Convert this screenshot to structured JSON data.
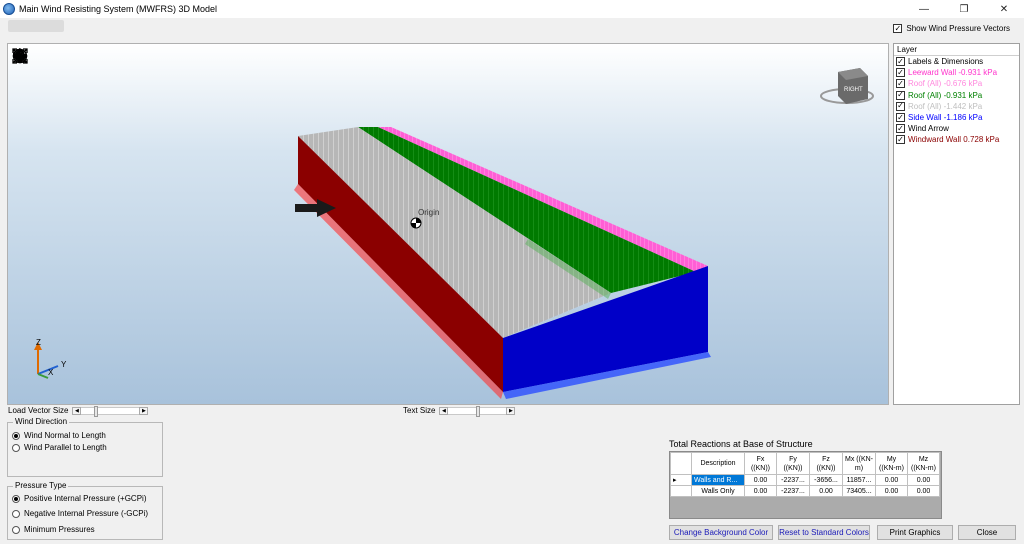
{
  "window": {
    "title": "Main Wind Resisting System (MWFRS) 3D Model",
    "minimize": "—",
    "restore": "❐",
    "close": "✕"
  },
  "options": {
    "show_wind_pressure_vectors": "Show Wind Pressure Vectors",
    "show_wind_pressure_vectors_checked": true
  },
  "viewport": {
    "origin_label": "Origin",
    "cube_label": "RIGHT",
    "axis_z": "Z",
    "axis_y": "Y",
    "axis_x": "X",
    "tools": [
      "home-icon",
      "orbit-icon",
      "zoom-window-icon",
      "zoom-icon",
      "pan-icon",
      "rotate-icon",
      "fit-extents-icon"
    ],
    "colors": {
      "windward_wall": "#8b0000",
      "side_wall": "#0000cc",
      "leeward_wall": "#ff33cc",
      "roof_green": "#008000",
      "roof_gray": "#b5b5b5"
    }
  },
  "layers": {
    "header": "Layer",
    "items": [
      {
        "label": "Labels & Dimensions",
        "color": "#000000",
        "checked": true
      },
      {
        "label": "Leeward Wall -0.931 kPa",
        "color": "#ff33cc",
        "checked": true
      },
      {
        "label": "Roof (All) -0.676 kPa",
        "color": "#ff88dd",
        "checked": true
      },
      {
        "label": "Roof (All) -0.931 kPa",
        "color": "#008000",
        "checked": true
      },
      {
        "label": "Roof (All) -1.442 kPa",
        "color": "#bfbfbf",
        "checked": true
      },
      {
        "label": "Side Wall -1.186 kPa",
        "color": "#0000ff",
        "checked": true
      },
      {
        "label": "Wind Arrow",
        "color": "#000000",
        "checked": true
      },
      {
        "label": "Windward Wall 0.728 kPa",
        "color": "#8b0000",
        "checked": true
      }
    ]
  },
  "controls": {
    "load_vector_size": "Load Vector Size",
    "load_vector_value": 0.2,
    "text_size": "Text Size",
    "text_size_value": 0.5
  },
  "wind_direction": {
    "title": "Wind Direction",
    "options": [
      {
        "label": "Wind Normal to Length",
        "selected": true
      },
      {
        "label": "Wind Parallel to Length",
        "selected": false
      }
    ]
  },
  "pressure_type": {
    "title": "Pressure Type",
    "options": [
      {
        "label": "Positive Internal Pressure (+GCPi)",
        "selected": true
      },
      {
        "label": "Negative Internal Pressure (-GCPi)",
        "selected": false
      },
      {
        "label": "Minimum Pressures",
        "selected": false
      }
    ]
  },
  "reactions": {
    "title": "Total Reactions at Base of Structure",
    "columns": [
      "Description",
      "Fx ((KN))",
      "Fy ((KN))",
      "Fz ((KN))",
      "Mx ((KN-m)",
      "My ((KN-m)",
      "Mz ((KN-m)"
    ],
    "rows": [
      {
        "marker": "▸",
        "cells": [
          "Walls and R...",
          "0.00",
          "-2237...",
          "-3656...",
          "11857...",
          "0.00",
          "0.00"
        ]
      },
      {
        "marker": "",
        "cells": [
          "Walls Only",
          "0.00",
          "-2237...",
          "0.00",
          "73405...",
          "0.00",
          "0.00"
        ]
      }
    ]
  },
  "buttons": {
    "change_bg": "Change Background Color",
    "reset_colors": "Reset to Standard Colors",
    "print": "Print Graphics",
    "close": "Close"
  }
}
